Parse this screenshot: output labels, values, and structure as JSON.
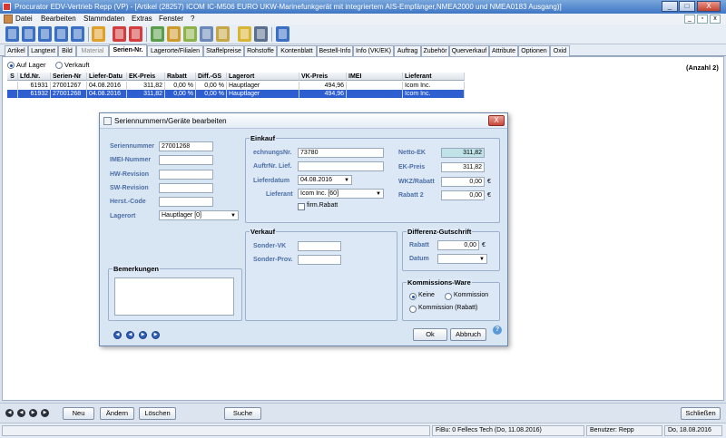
{
  "window": {
    "title": "Procurator EDV-Vertrieb Repp (VP) - [Artikel (28257) ICOM IC-M506 EURO UKW-Marinefunkgerät mit integriertem AIS-Empfänger,NMEA2000 und NMEA0183 Ausgang)]",
    "minimize": "_",
    "restore": "□",
    "close": "X"
  },
  "menu": {
    "items": [
      "Datei",
      "Bearbeiten",
      "Stammdaten",
      "Extras",
      "Fenster",
      "?"
    ],
    "mdi_buttons": [
      "_",
      "▫",
      "x"
    ]
  },
  "toolbar": {
    "colors": [
      "#3a6fc4",
      "#3a6fc4",
      "#3a6fc4",
      "#3a6fc4",
      "#3a6fc4",
      "#e0a12a",
      "#d43d3d",
      "#d43d3d",
      "#5a9e4b",
      "#cf9a2c",
      "#8eb24a",
      "#6b88b8",
      "#c7a646",
      "#d9b534",
      "#5a6f8d"
    ]
  },
  "tabs": [
    {
      "label": "Artikel",
      "state": "normal"
    },
    {
      "label": "Langtext",
      "state": "normal"
    },
    {
      "label": "Bild",
      "state": "normal"
    },
    {
      "label": "Material",
      "state": "disabled"
    },
    {
      "label": "Serien-Nr.",
      "state": "active"
    },
    {
      "label": "Lagerorte/Filialen",
      "state": "normal"
    },
    {
      "label": "Staffelpreise",
      "state": "normal"
    },
    {
      "label": "Rohstoffe",
      "state": "normal"
    },
    {
      "label": "Kontenblatt",
      "state": "normal"
    },
    {
      "label": "Bestell-Info",
      "state": "normal"
    },
    {
      "label": "Info (VK/EK)",
      "state": "normal"
    },
    {
      "label": "Auftrag",
      "state": "normal"
    },
    {
      "label": "Zubehör",
      "state": "normal"
    },
    {
      "label": "Querverkauf",
      "state": "normal"
    },
    {
      "label": "Attribute",
      "state": "normal"
    },
    {
      "label": "Optionen",
      "state": "normal"
    },
    {
      "label": "Oxid",
      "state": "normal"
    }
  ],
  "filter": {
    "auf_lager": "Auf Lager",
    "verkauft": "Verkauft",
    "selected": "auf_lager",
    "count": "(Anzahl 2)"
  },
  "grid": {
    "columns": [
      "S",
      "Lfd.Nr.",
      "Serien-Nr",
      "Liefer-Datu",
      "EK-Preis",
      "Rabatt",
      "Diff.-GS",
      "Lagerort",
      "VK-Preis",
      "IMEI",
      "Lieferant"
    ],
    "rows": [
      [
        "",
        "61931",
        "27001267",
        "04.08.2016",
        "311,82",
        "0,00 %",
        "0,00 %",
        "Hauptlager",
        "494,96",
        "",
        "Icom Inc."
      ],
      [
        "",
        "61932",
        "27001268",
        "04.08.2016",
        "311,82",
        "0,00 %",
        "0,00 %",
        "Hauptlager",
        "494,96",
        "",
        "Icom Inc."
      ]
    ]
  },
  "dialog": {
    "title": "Seriennummern/Geräte bearbeiten",
    "close": "X",
    "left": {
      "seriennummer_label": "Seriennummer",
      "seriennummer": "27001268",
      "imei_label": "IMEI-Nummer",
      "imei": "",
      "hw_label": "HW-Revision",
      "hw": "",
      "sw_label": "SW-Revision",
      "sw": "",
      "herst_label": "Herst.-Code",
      "herst": "",
      "lagerort_label": "Lagerort",
      "lagerort": "Hauptlager [0]"
    },
    "einkauf": {
      "title": "Einkauf",
      "rechnungsnr_label": "echnungsNr.",
      "rechnungsnr": "73780",
      "auftrnr_label": "AuftrNr. Lief.",
      "auftrnr": "",
      "lieferdatum_label": "Lieferdatum",
      "lieferdatum": "04.08.2016",
      "lieferant_label": "Lieferant",
      "lieferant": "Icom Inc. [60]",
      "firm_rabatt": "firm.Rabatt",
      "netto_ek_label": "Netto-EK",
      "netto_ek": "311,82",
      "ek_preis_label": "EK-Preis",
      "ek_preis": "311,82",
      "wkz_label": "WKZ/Rabatt",
      "wkz": "0,00",
      "rabatt2_label": "Rabatt 2",
      "rabatt2": "0,00",
      "currency": "€"
    },
    "verkauf": {
      "title": "Verkauf",
      "sonder_vk_label": "Sonder-VK",
      "sonder_vk": "",
      "sonder_prov_label": "Sonder-Prov.",
      "sonder_prov": ""
    },
    "differenz": {
      "title": "Differenz-Gutschrift",
      "rabatt_label": "Rabatt",
      "rabatt": "0,00",
      "datum_label": "Datum",
      "datum": "",
      "currency": "€"
    },
    "kommission": {
      "title": "Kommissions-Ware",
      "keine": "Keine",
      "kommission": "Kommission",
      "kommission_rabatt": "Kommission (Rabatt)",
      "selected": "keine"
    },
    "bemerkungen": {
      "title": "Bemerkungen",
      "text": ""
    },
    "ok": "Ok",
    "abbruch": "Abbruch",
    "help": "?"
  },
  "bottom": {
    "neu": "Neu",
    "aendern": "Ändern",
    "loeschen": "Löschen",
    "suche": "Suche",
    "schliessen": "Schließen"
  },
  "status": {
    "fibu": "FiBu: 0 Fellecs Tech (Do, 11.08.2016)",
    "benutzer": "Benutzer: Repp",
    "datum": "Do, 18.08.2016"
  }
}
